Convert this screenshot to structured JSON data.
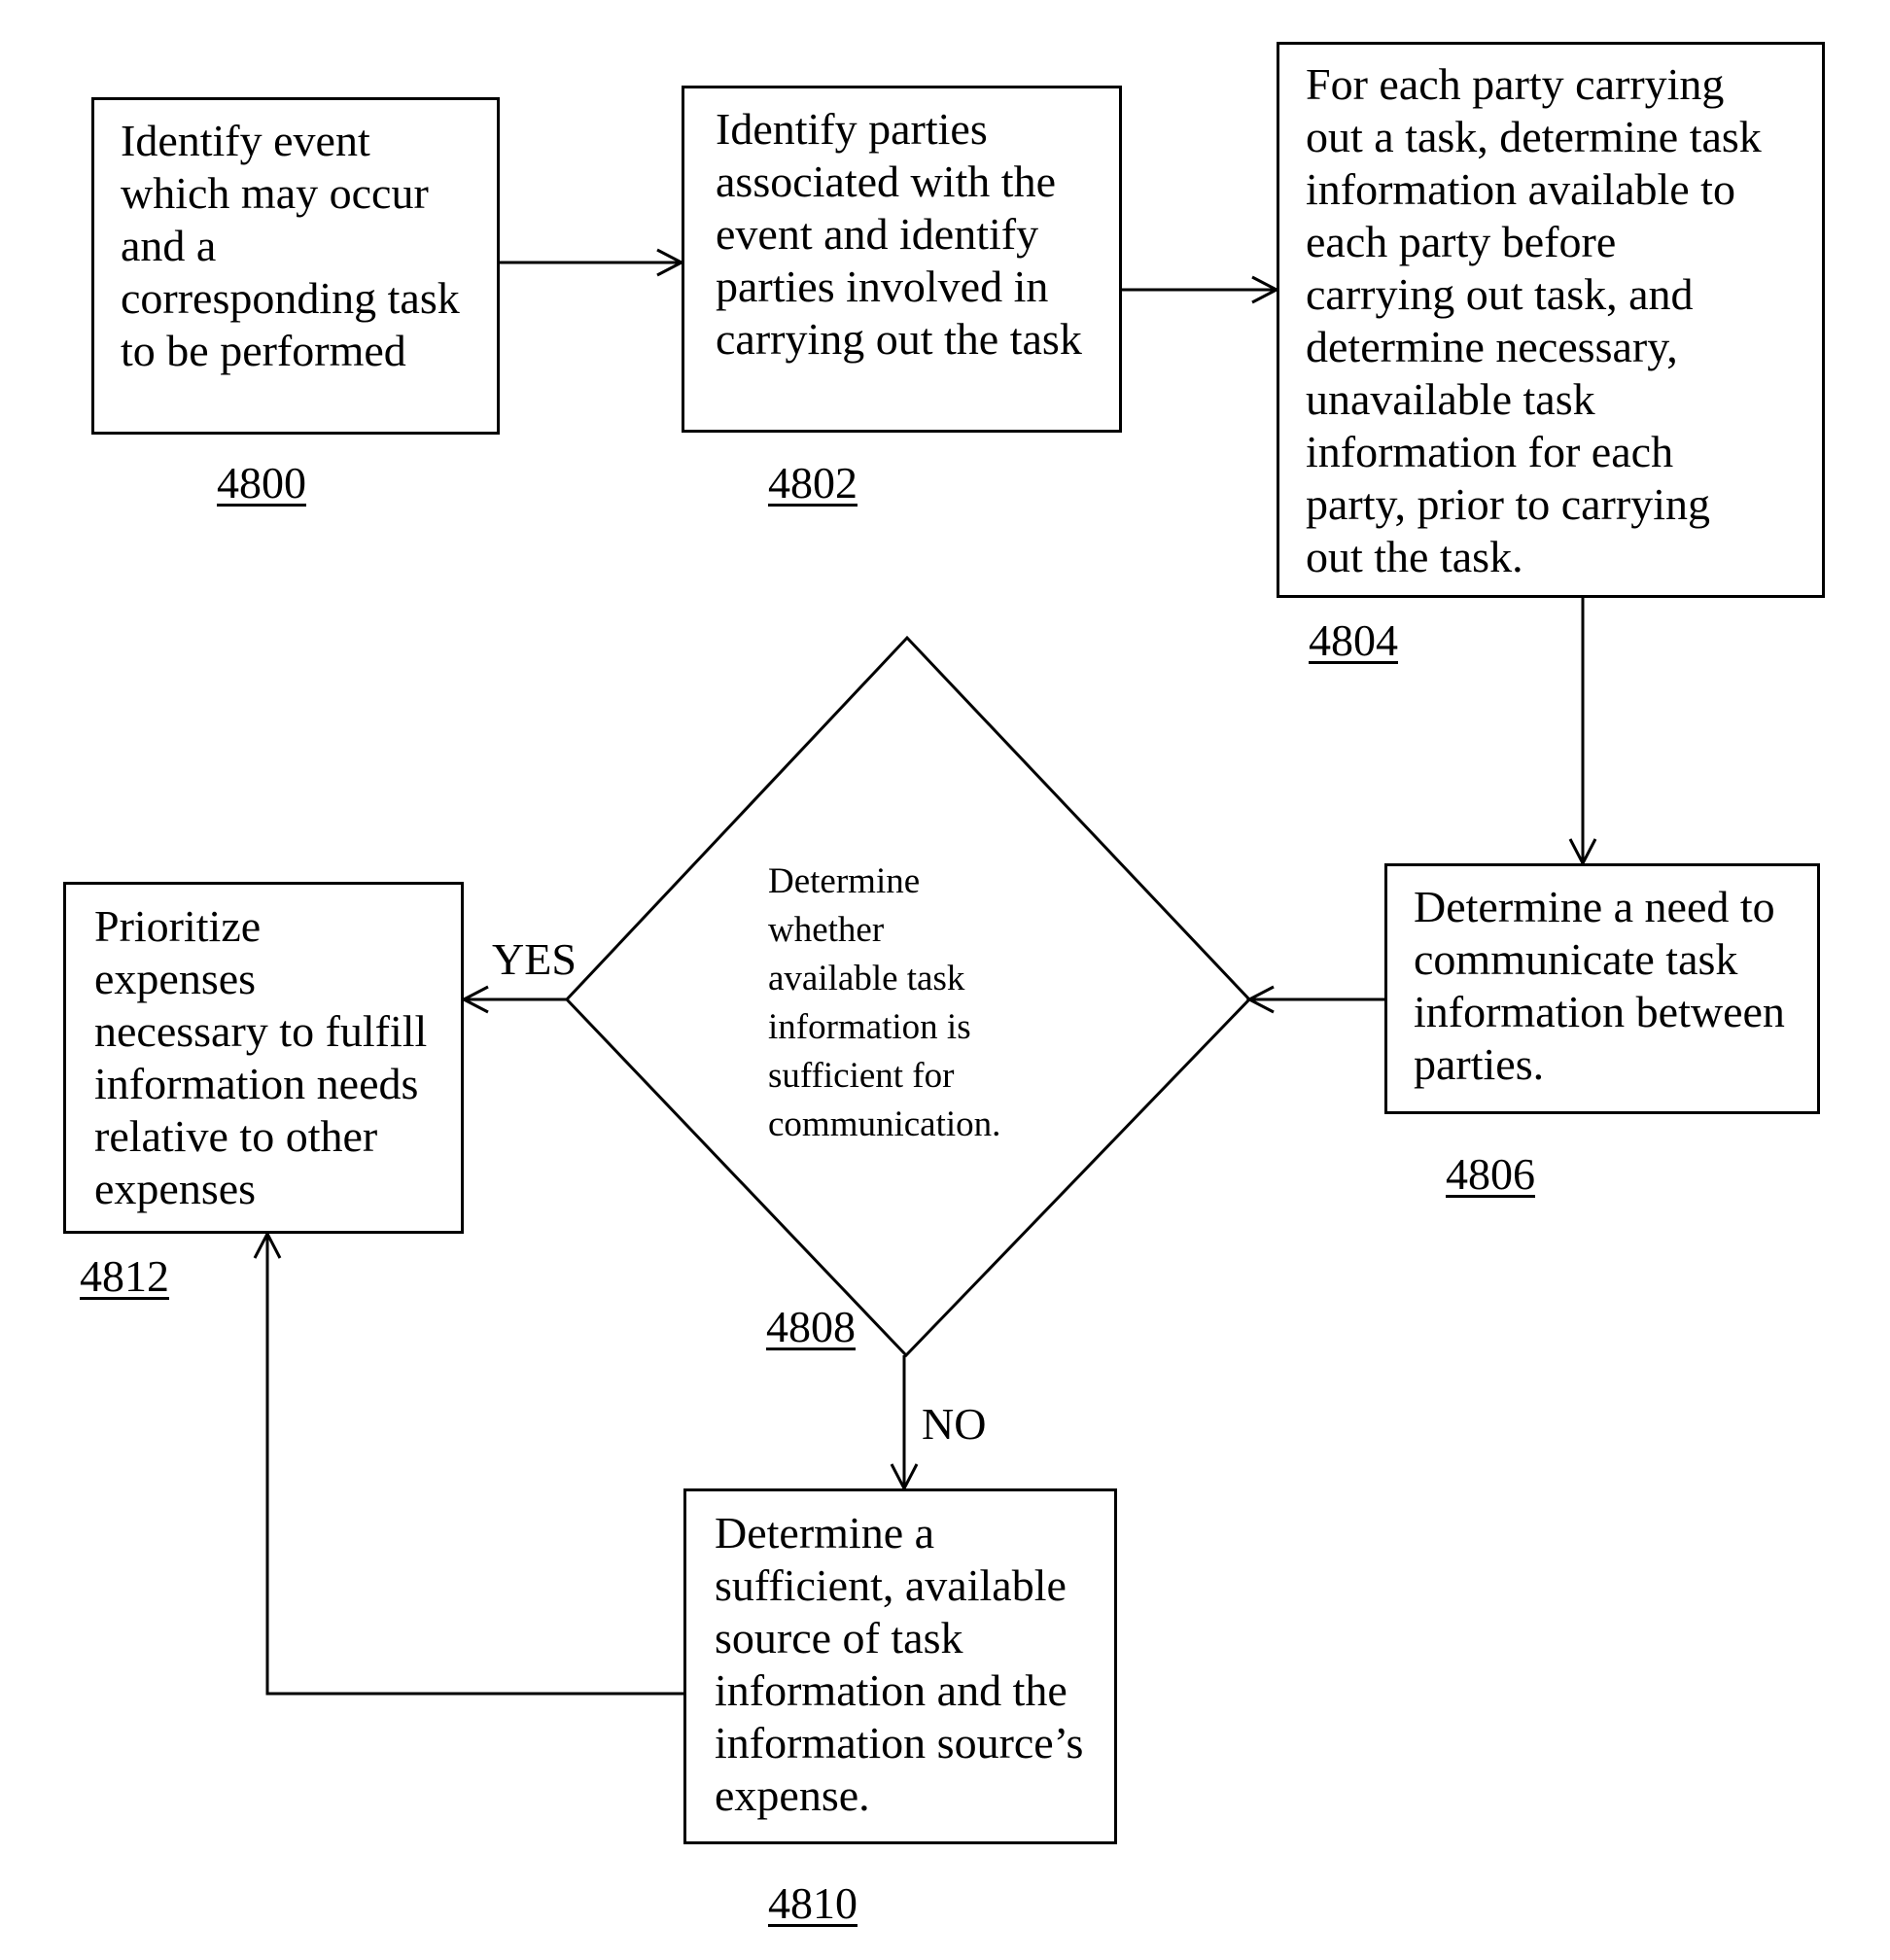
{
  "figure": {
    "type": "flowchart",
    "steps": [
      {
        "id": "4800",
        "ref": "4800",
        "shape": "process",
        "text": "Identify event\nwhich may occur\nand a\ncorresponding task\nto be performed"
      },
      {
        "id": "4802",
        "ref": "4802",
        "shape": "process",
        "text": "Identify parties\nassociated with the\nevent and identify\nparties involved in\ncarrying out the task"
      },
      {
        "id": "4804",
        "ref": "4804",
        "shape": "process",
        "text": "For each party carrying\nout a task, determine task\ninformation available to\neach party before\ncarrying out task, and\ndetermine necessary,\nunavailable task\ninformation for each\nparty, prior to carrying\nout the task."
      },
      {
        "id": "4806",
        "ref": "4806",
        "shape": "process",
        "text": "Determine a need to\ncommunicate task\ninformation between\nparties."
      },
      {
        "id": "4808",
        "ref": "4808",
        "shape": "decision",
        "text": "Determine\nwhether\navailable task\ninformation is\nsufficient for\ncommunication."
      },
      {
        "id": "4810",
        "ref": "4810",
        "shape": "process",
        "text": "Determine a\nsufficient, available\nsource of task\ninformation and the\ninformation source’s\nexpense."
      },
      {
        "id": "4812",
        "ref": "4812",
        "shape": "process",
        "text": "Prioritize\nexpenses\nnecessary to fulfill\ninformation needs\nrelative to other\nexpenses"
      }
    ],
    "edges": [
      {
        "from": "4800",
        "to": "4802",
        "label": ""
      },
      {
        "from": "4802",
        "to": "4804",
        "label": ""
      },
      {
        "from": "4804",
        "to": "4806",
        "label": ""
      },
      {
        "from": "4806",
        "to": "4808",
        "label": ""
      },
      {
        "from": "4808",
        "to": "4812",
        "label": "YES"
      },
      {
        "from": "4808",
        "to": "4810",
        "label": "NO"
      },
      {
        "from": "4810",
        "to": "4812",
        "label": ""
      }
    ],
    "branch_labels": {
      "yes": "YES",
      "no": "NO"
    }
  }
}
